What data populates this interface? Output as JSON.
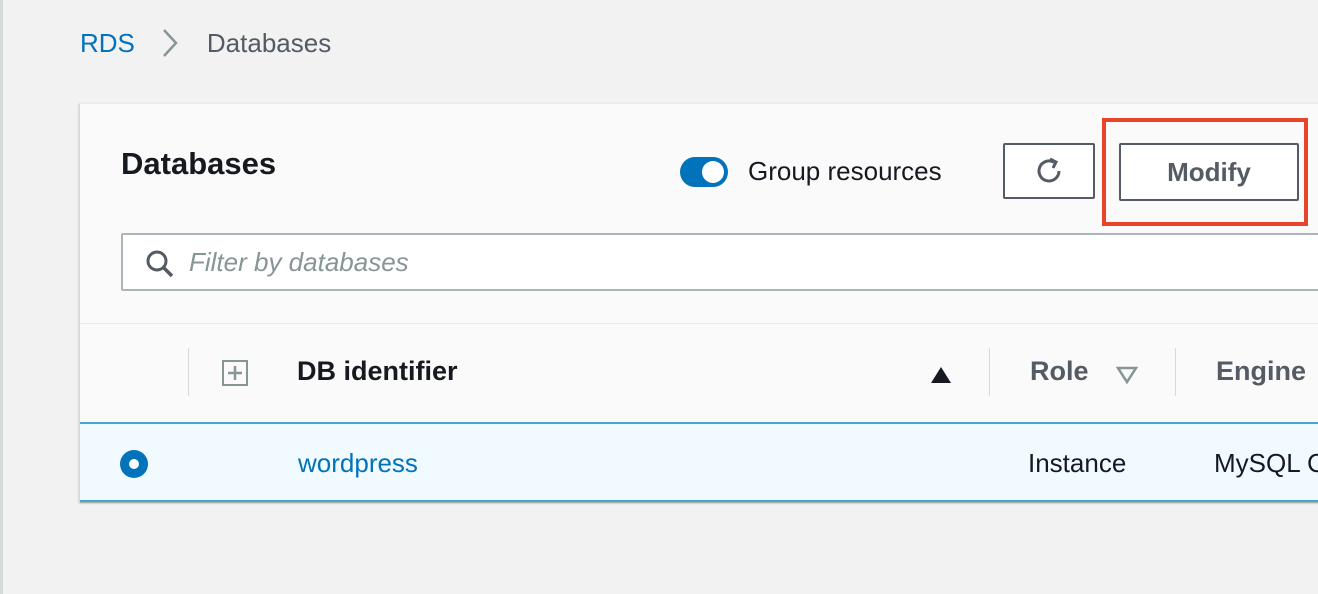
{
  "breadcrumb": {
    "root_label": "RDS",
    "current_label": "Databases"
  },
  "panel": {
    "title": "Databases",
    "group_toggle": {
      "label": "Group resources",
      "enabled": true
    },
    "refresh_icon": "refresh-icon",
    "modify_label": "Modify",
    "filter": {
      "placeholder": "Filter by databases",
      "value": ""
    }
  },
  "table": {
    "columns": [
      {
        "label": "DB identifier",
        "sort": "ascending"
      },
      {
        "label": "Role",
        "sort": "none"
      },
      {
        "label": "Engine"
      }
    ],
    "rows": [
      {
        "selected": true,
        "db_identifier": "wordpress",
        "role": "Instance",
        "engine": "MySQL C"
      }
    ]
  },
  "colors": {
    "accent": "#0073bb",
    "highlight": "#e8442a",
    "selected_row_bg": "#f1faff",
    "row_border": "#44a9c9"
  }
}
